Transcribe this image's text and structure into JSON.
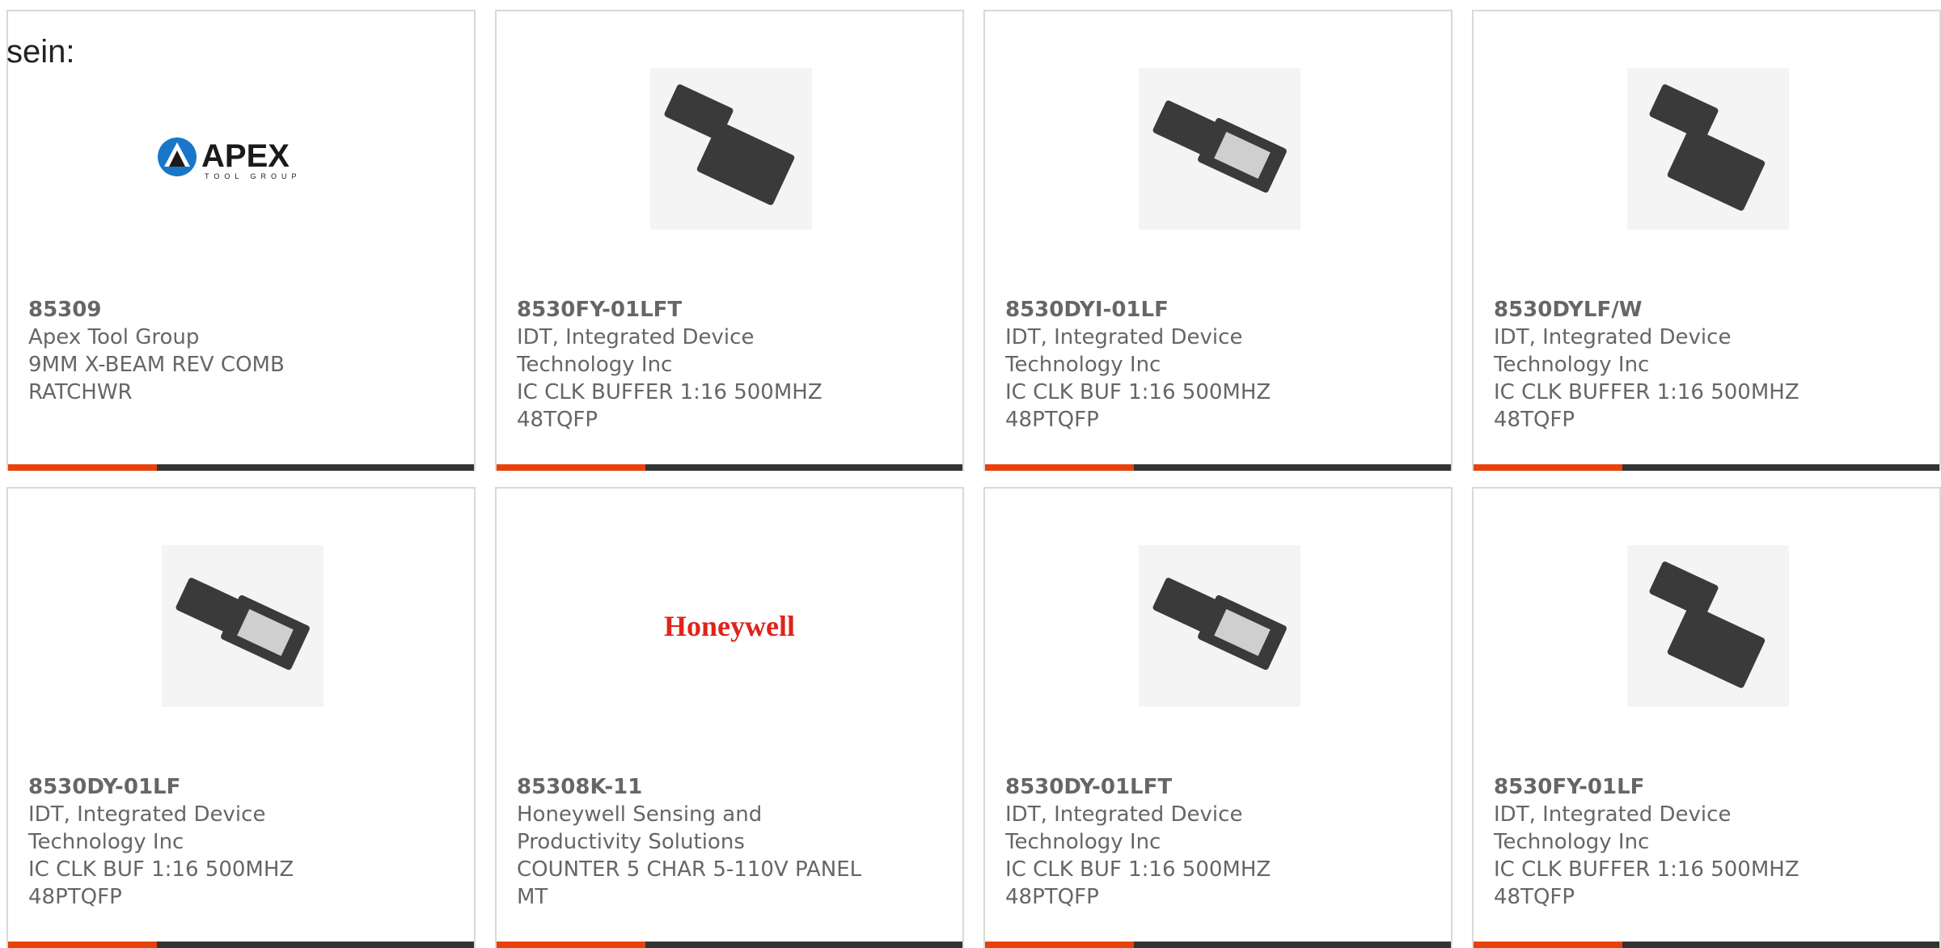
{
  "intro_text": "sein:",
  "colors": {
    "accent": "#e8410c",
    "bar": "#333333",
    "text": "#666666"
  },
  "products": [
    {
      "part": "85309",
      "maker": "Apex Tool Group",
      "desc": "9MM X-BEAM REV COMB RATCHWR",
      "image": "apex-logo",
      "logo_text": "APEX",
      "logo_sub": "TOOL GROUP"
    },
    {
      "part": "8530FY-01LFT",
      "maker": "IDT, Integrated Device Technology Inc",
      "desc": "IC CLK BUFFER 1:16 500MHZ 48TQFP",
      "image": "chip-photo"
    },
    {
      "part": "8530DYI-01LF",
      "maker": "IDT, Integrated Device Technology Inc",
      "desc": "IC CLK BUF 1:16 500MHZ 48PTQFP",
      "image": "chip-photo"
    },
    {
      "part": "8530DYLF/W",
      "maker": "IDT, Integrated Device Technology Inc",
      "desc": "IC CLK BUFFER 1:16 500MHZ 48TQFP",
      "image": "chip-photo"
    },
    {
      "part": "8530DY-01LF",
      "maker": "IDT, Integrated Device Technology Inc",
      "desc": "IC CLK BUF 1:16 500MHZ 48PTQFP",
      "image": "chip-photo"
    },
    {
      "part": "85308K-11",
      "maker": "Honeywell Sensing and Productivity Solutions",
      "desc": "COUNTER 5 CHAR 5-110V PANEL MT",
      "image": "honeywell-logo",
      "logo_text": "Honeywell"
    },
    {
      "part": "8530DY-01LFT",
      "maker": "IDT, Integrated Device Technology Inc",
      "desc": "IC CLK BUF 1:16 500MHZ 48PTQFP",
      "image": "chip-photo"
    },
    {
      "part": "8530FY-01LF",
      "maker": "IDT, Integrated Device Technology Inc",
      "desc": "IC CLK BUFFER 1:16 500MHZ 48TQFP",
      "image": "chip-photo"
    }
  ]
}
